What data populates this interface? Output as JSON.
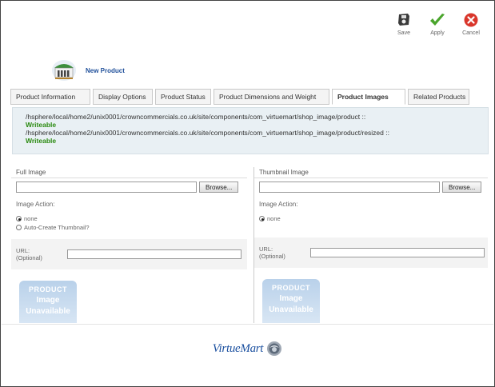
{
  "toolbar": {
    "save_label": "Save",
    "apply_label": "Apply",
    "cancel_label": "Cancel"
  },
  "header": {
    "title": "New Product"
  },
  "tabs": [
    {
      "label": "Product Information",
      "active": false
    },
    {
      "label": "Display Options",
      "active": false
    },
    {
      "label": "Product Status",
      "active": false
    },
    {
      "label": "Product Dimensions and Weight",
      "active": false
    },
    {
      "label": "Product Images",
      "active": true
    },
    {
      "label": "Related Products",
      "active": false
    }
  ],
  "info": {
    "path1": "/hsphere/local/home2/unix0001/crowncommercials.co.uk/site/components/com_virtuemart/shop_image/product ::",
    "status1": "Writeable",
    "path2": "/hsphere/local/home2/unix0001/crowncommercials.co.uk/site/components/com_virtuemart/shop_image/product/resized ::",
    "status2": "Writeable"
  },
  "full_image": {
    "title": "Full Image",
    "browse_label": "Browse...",
    "action_label": "Image Action:",
    "option_none": "none",
    "option_auto": "Auto-Create Thumbnail?",
    "url_label_1": "URL:",
    "url_label_2": "(Optional)",
    "placeholder_top": "PRODUCT",
    "placeholder_line1": "Image",
    "placeholder_line2": "Unavailable"
  },
  "thumb_image": {
    "title": "Thumbnail Image",
    "browse_label": "Browse...",
    "action_label": "Image Action:",
    "option_none": "none",
    "url_label_1": "URL:",
    "url_label_2": "(Optional)",
    "placeholder_top": "PRODUCT",
    "placeholder_line1": "Image",
    "placeholder_line2": "Unavailable"
  },
  "footer": {
    "logo_text": "VirtueMart"
  },
  "colors": {
    "accent_blue": "#1f4f9a",
    "writeable_green": "#2a8a10",
    "info_bg": "#e9f0f4"
  }
}
